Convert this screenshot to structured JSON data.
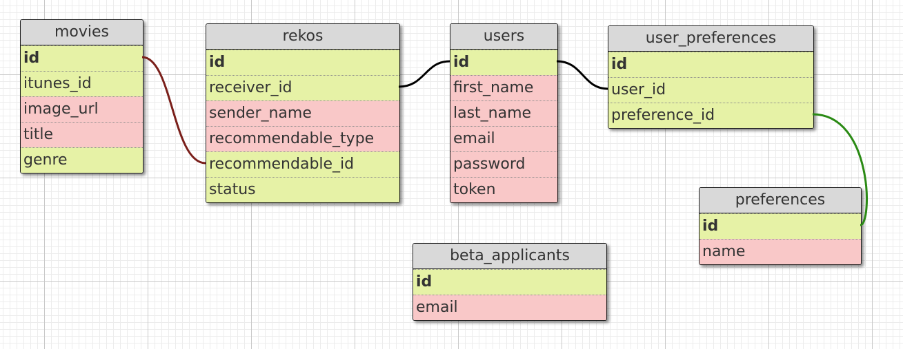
{
  "colors": {
    "key_field": "#e6f2a6",
    "data_field": "#f9c8c8",
    "header": "#d9d9d9",
    "rel_movies_rekos": "#7a1f1a",
    "rel_rekos_users": "#000000",
    "rel_users_prefs": "#000000",
    "rel_prefs_preferences": "#2a8a14"
  },
  "tables": {
    "movies": {
      "title": "movies",
      "fields": [
        {
          "name": "id",
          "pk": true,
          "kind": "key"
        },
        {
          "name": "itunes_id",
          "pk": false,
          "kind": "key"
        },
        {
          "name": "image_url",
          "pk": false,
          "kind": "data"
        },
        {
          "name": "title",
          "pk": false,
          "kind": "data"
        },
        {
          "name": "genre",
          "pk": false,
          "kind": "key"
        }
      ]
    },
    "rekos": {
      "title": "rekos",
      "fields": [
        {
          "name": "id",
          "pk": true,
          "kind": "key"
        },
        {
          "name": "receiver_id",
          "pk": false,
          "kind": "key"
        },
        {
          "name": "sender_name",
          "pk": false,
          "kind": "data"
        },
        {
          "name": "recommendable_type",
          "pk": false,
          "kind": "data"
        },
        {
          "name": "recommendable_id",
          "pk": false,
          "kind": "key"
        },
        {
          "name": "status",
          "pk": false,
          "kind": "key"
        }
      ]
    },
    "users": {
      "title": "users",
      "fields": [
        {
          "name": "id",
          "pk": true,
          "kind": "key"
        },
        {
          "name": "first_name",
          "pk": false,
          "kind": "data"
        },
        {
          "name": "last_name",
          "pk": false,
          "kind": "data"
        },
        {
          "name": "email",
          "pk": false,
          "kind": "data"
        },
        {
          "name": "password",
          "pk": false,
          "kind": "data"
        },
        {
          "name": "token",
          "pk": false,
          "kind": "data"
        }
      ]
    },
    "user_preferences": {
      "title": "user_preferences",
      "fields": [
        {
          "name": "id",
          "pk": true,
          "kind": "key"
        },
        {
          "name": "user_id",
          "pk": false,
          "kind": "key"
        },
        {
          "name": "preference_id",
          "pk": false,
          "kind": "key"
        }
      ]
    },
    "preferences": {
      "title": "preferences",
      "fields": [
        {
          "name": "id",
          "pk": true,
          "kind": "key"
        },
        {
          "name": "name",
          "pk": false,
          "kind": "data"
        }
      ]
    },
    "beta_applicants": {
      "title": "beta_applicants",
      "fields": [
        {
          "name": "id",
          "pk": true,
          "kind": "key"
        },
        {
          "name": "email",
          "pk": false,
          "kind": "data"
        }
      ]
    }
  },
  "relations": [
    {
      "from": "movies.id",
      "to": "rekos.recommendable_id",
      "color_key": "rel_movies_rekos"
    },
    {
      "from": "rekos.receiver_id",
      "to": "users.id",
      "color_key": "rel_rekos_users"
    },
    {
      "from": "users.id",
      "to": "user_preferences.user_id",
      "color_key": "rel_users_prefs"
    },
    {
      "from": "user_preferences.preference_id",
      "to": "preferences.id",
      "color_key": "rel_prefs_preferences"
    }
  ]
}
